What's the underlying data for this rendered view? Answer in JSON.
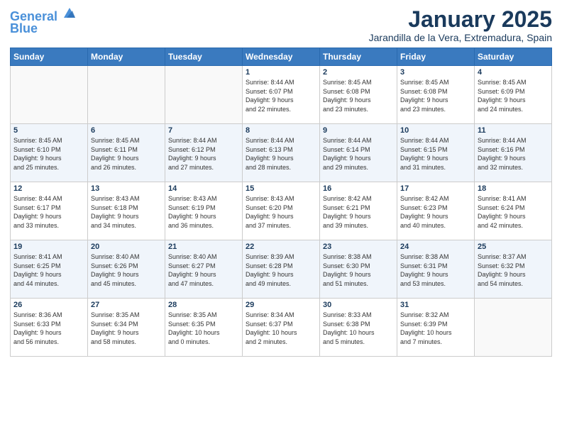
{
  "header": {
    "logo_line1": "General",
    "logo_line2": "Blue",
    "month": "January 2025",
    "location": "Jarandilla de la Vera, Extremadura, Spain"
  },
  "days_of_week": [
    "Sunday",
    "Monday",
    "Tuesday",
    "Wednesday",
    "Thursday",
    "Friday",
    "Saturday"
  ],
  "weeks": [
    [
      {
        "day": "",
        "info": ""
      },
      {
        "day": "",
        "info": ""
      },
      {
        "day": "",
        "info": ""
      },
      {
        "day": "1",
        "info": "Sunrise: 8:44 AM\nSunset: 6:07 PM\nDaylight: 9 hours\nand 22 minutes."
      },
      {
        "day": "2",
        "info": "Sunrise: 8:45 AM\nSunset: 6:08 PM\nDaylight: 9 hours\nand 23 minutes."
      },
      {
        "day": "3",
        "info": "Sunrise: 8:45 AM\nSunset: 6:08 PM\nDaylight: 9 hours\nand 23 minutes."
      },
      {
        "day": "4",
        "info": "Sunrise: 8:45 AM\nSunset: 6:09 PM\nDaylight: 9 hours\nand 24 minutes."
      }
    ],
    [
      {
        "day": "5",
        "info": "Sunrise: 8:45 AM\nSunset: 6:10 PM\nDaylight: 9 hours\nand 25 minutes."
      },
      {
        "day": "6",
        "info": "Sunrise: 8:45 AM\nSunset: 6:11 PM\nDaylight: 9 hours\nand 26 minutes."
      },
      {
        "day": "7",
        "info": "Sunrise: 8:44 AM\nSunset: 6:12 PM\nDaylight: 9 hours\nand 27 minutes."
      },
      {
        "day": "8",
        "info": "Sunrise: 8:44 AM\nSunset: 6:13 PM\nDaylight: 9 hours\nand 28 minutes."
      },
      {
        "day": "9",
        "info": "Sunrise: 8:44 AM\nSunset: 6:14 PM\nDaylight: 9 hours\nand 29 minutes."
      },
      {
        "day": "10",
        "info": "Sunrise: 8:44 AM\nSunset: 6:15 PM\nDaylight: 9 hours\nand 31 minutes."
      },
      {
        "day": "11",
        "info": "Sunrise: 8:44 AM\nSunset: 6:16 PM\nDaylight: 9 hours\nand 32 minutes."
      }
    ],
    [
      {
        "day": "12",
        "info": "Sunrise: 8:44 AM\nSunset: 6:17 PM\nDaylight: 9 hours\nand 33 minutes."
      },
      {
        "day": "13",
        "info": "Sunrise: 8:43 AM\nSunset: 6:18 PM\nDaylight: 9 hours\nand 34 minutes."
      },
      {
        "day": "14",
        "info": "Sunrise: 8:43 AM\nSunset: 6:19 PM\nDaylight: 9 hours\nand 36 minutes."
      },
      {
        "day": "15",
        "info": "Sunrise: 8:43 AM\nSunset: 6:20 PM\nDaylight: 9 hours\nand 37 minutes."
      },
      {
        "day": "16",
        "info": "Sunrise: 8:42 AM\nSunset: 6:21 PM\nDaylight: 9 hours\nand 39 minutes."
      },
      {
        "day": "17",
        "info": "Sunrise: 8:42 AM\nSunset: 6:23 PM\nDaylight: 9 hours\nand 40 minutes."
      },
      {
        "day": "18",
        "info": "Sunrise: 8:41 AM\nSunset: 6:24 PM\nDaylight: 9 hours\nand 42 minutes."
      }
    ],
    [
      {
        "day": "19",
        "info": "Sunrise: 8:41 AM\nSunset: 6:25 PM\nDaylight: 9 hours\nand 44 minutes."
      },
      {
        "day": "20",
        "info": "Sunrise: 8:40 AM\nSunset: 6:26 PM\nDaylight: 9 hours\nand 45 minutes."
      },
      {
        "day": "21",
        "info": "Sunrise: 8:40 AM\nSunset: 6:27 PM\nDaylight: 9 hours\nand 47 minutes."
      },
      {
        "day": "22",
        "info": "Sunrise: 8:39 AM\nSunset: 6:28 PM\nDaylight: 9 hours\nand 49 minutes."
      },
      {
        "day": "23",
        "info": "Sunrise: 8:38 AM\nSunset: 6:30 PM\nDaylight: 9 hours\nand 51 minutes."
      },
      {
        "day": "24",
        "info": "Sunrise: 8:38 AM\nSunset: 6:31 PM\nDaylight: 9 hours\nand 53 minutes."
      },
      {
        "day": "25",
        "info": "Sunrise: 8:37 AM\nSunset: 6:32 PM\nDaylight: 9 hours\nand 54 minutes."
      }
    ],
    [
      {
        "day": "26",
        "info": "Sunrise: 8:36 AM\nSunset: 6:33 PM\nDaylight: 9 hours\nand 56 minutes."
      },
      {
        "day": "27",
        "info": "Sunrise: 8:35 AM\nSunset: 6:34 PM\nDaylight: 9 hours\nand 58 minutes."
      },
      {
        "day": "28",
        "info": "Sunrise: 8:35 AM\nSunset: 6:35 PM\nDaylight: 10 hours\nand 0 minutes."
      },
      {
        "day": "29",
        "info": "Sunrise: 8:34 AM\nSunset: 6:37 PM\nDaylight: 10 hours\nand 2 minutes."
      },
      {
        "day": "30",
        "info": "Sunrise: 8:33 AM\nSunset: 6:38 PM\nDaylight: 10 hours\nand 5 minutes."
      },
      {
        "day": "31",
        "info": "Sunrise: 8:32 AM\nSunset: 6:39 PM\nDaylight: 10 hours\nand 7 minutes."
      },
      {
        "day": "",
        "info": ""
      }
    ]
  ]
}
